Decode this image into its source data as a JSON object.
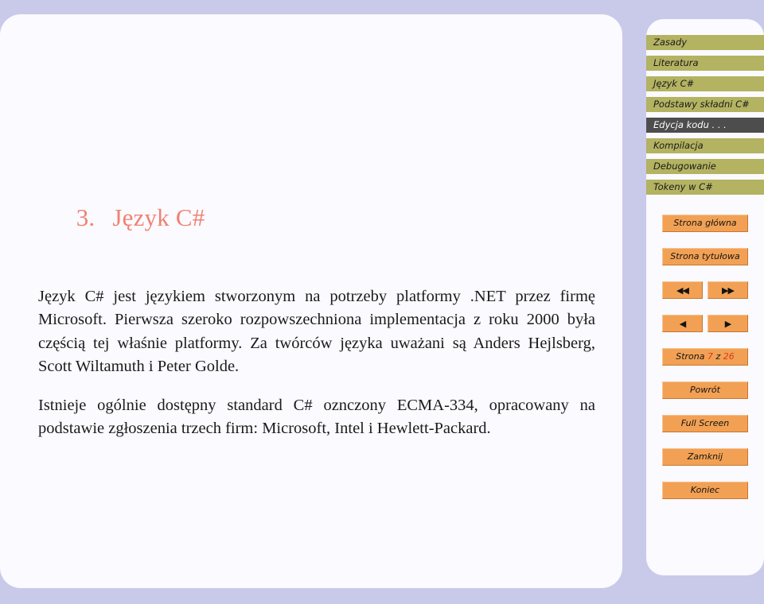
{
  "theme": {
    "page_background": "#c9c9ea",
    "panel_background": "#fafaff",
    "nav_item_background": "#b3b362",
    "nav_item_current_background": "#4d4d4d",
    "button_background": "#f2a154",
    "title_color": "#f08273",
    "accent_red": "#d8391b"
  },
  "slide": {
    "number": "3.",
    "title": "Język C#",
    "paragraphs": [
      "Język C# jest językiem stworzonym na potrzeby platformy .NET przez firmę Microsoft. Pierwsza szeroko rozpowszechniona implementacja z roku 2000 była częścią tej właśnie platformy. Za twórców języka uważani są Anders Hejlsberg, Scott Wiltamuth i Peter Golde.",
      "Istnieje ogólnie dostępny standard C# oznczony ECMA-334, opracowany na podstawie zgłoszenia trzech firm: Microsoft, Intel i Hewlett-Packard."
    ]
  },
  "sidebar": {
    "nav_items": [
      {
        "label": "Zasady",
        "current": false
      },
      {
        "label": "Literatura",
        "current": false
      },
      {
        "label": "Język C#",
        "current": false
      },
      {
        "label": "Podstawy składni C#",
        "current": false
      },
      {
        "label": "Edycja kodu . . .",
        "current": true
      },
      {
        "label": "Kompilacja",
        "current": false
      },
      {
        "label": "Debugowanie",
        "current": false
      },
      {
        "label": "Tokeny w C#",
        "current": false
      }
    ],
    "buttons": {
      "home": "Strona główna",
      "title_page": "Strona tytułowa",
      "first": "◀◀",
      "last": "▶▶",
      "prev": "◀",
      "next": "▶",
      "page_word": "Strona",
      "page_current": "7",
      "page_of": "z",
      "page_total": "26",
      "back": "Powrót",
      "full_screen": "Full Screen",
      "close": "Zamknij",
      "quit": "Koniec"
    }
  }
}
